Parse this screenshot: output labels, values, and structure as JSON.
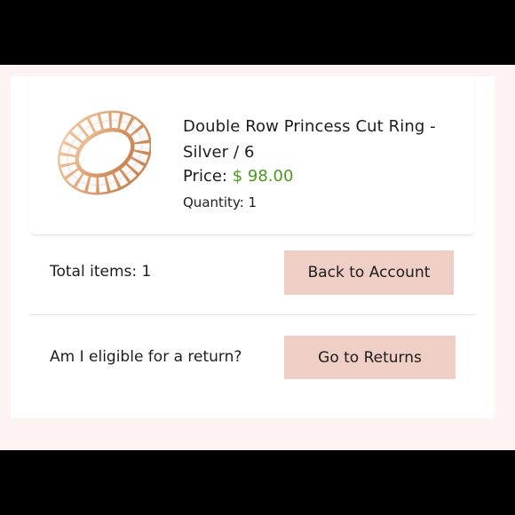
{
  "order_item": {
    "name": "Double Row Princess Cut Ring - Silver / 6",
    "price_label": "Price:",
    "price_value": "$ 98.00",
    "quantity_text": "Quantity: 1"
  },
  "summary": {
    "total_items_text": "Total items: 1",
    "back_button_label": "Back to Account"
  },
  "returns": {
    "question_text": "Am I eligible for a return?",
    "button_label": "Go to Returns"
  },
  "colors": {
    "price_accent": "#4a9a1e",
    "button_bg": "#efcfc5",
    "page_bg": "#fdf3f3"
  }
}
